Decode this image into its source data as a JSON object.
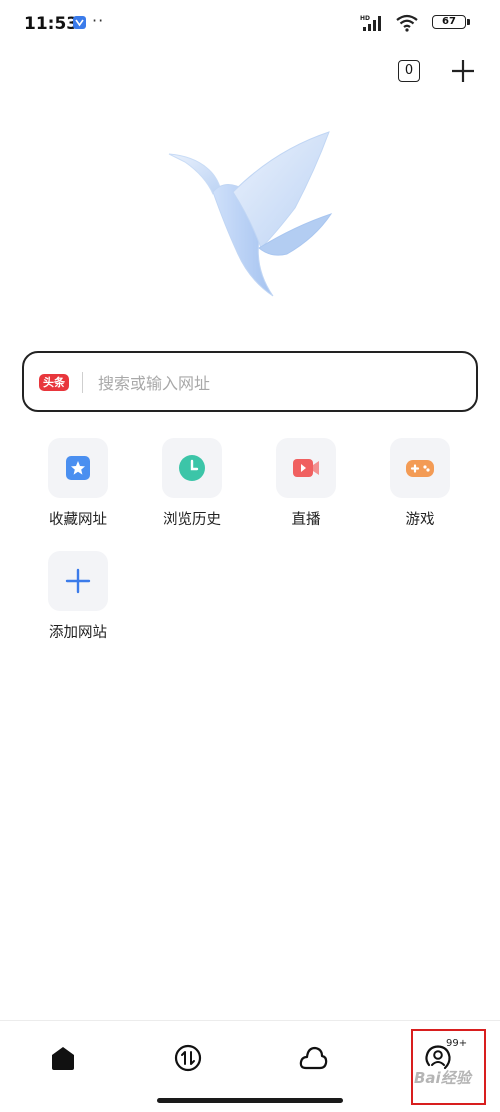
{
  "status_bar": {
    "time": "11:53",
    "dots": "··",
    "signal_label": "HD",
    "battery_level": "67"
  },
  "top_actions": {
    "tab_count": "0"
  },
  "search": {
    "engine_badge": "头条",
    "placeholder": "搜索或输入网址"
  },
  "quick_links": [
    {
      "label": "收藏网址",
      "icon": "star-bookmark-icon",
      "color": "#4a8ff0"
    },
    {
      "label": "浏览历史",
      "icon": "clock-history-icon",
      "color": "#3cc5a8"
    },
    {
      "label": "直播",
      "icon": "video-camera-icon",
      "color": "#f06060"
    },
    {
      "label": "游戏",
      "icon": "gamepad-icon",
      "color": "#f39b55"
    },
    {
      "label": "添加网站",
      "icon": "plus-icon",
      "color": "#3b7bea"
    }
  ],
  "bottom_nav": {
    "items": [
      {
        "name": "home",
        "icon": "home-icon"
      },
      {
        "name": "transfer",
        "icon": "transfer-arrows-icon"
      },
      {
        "name": "cloud",
        "icon": "cloud-icon"
      },
      {
        "name": "profile",
        "icon": "user-icon"
      }
    ],
    "profile_badge": "99+"
  },
  "watermark": "Bai经验",
  "colors": {
    "accent": "#3b7bea",
    "badge_red": "#e8363c",
    "highlight": "#d81e1e"
  }
}
